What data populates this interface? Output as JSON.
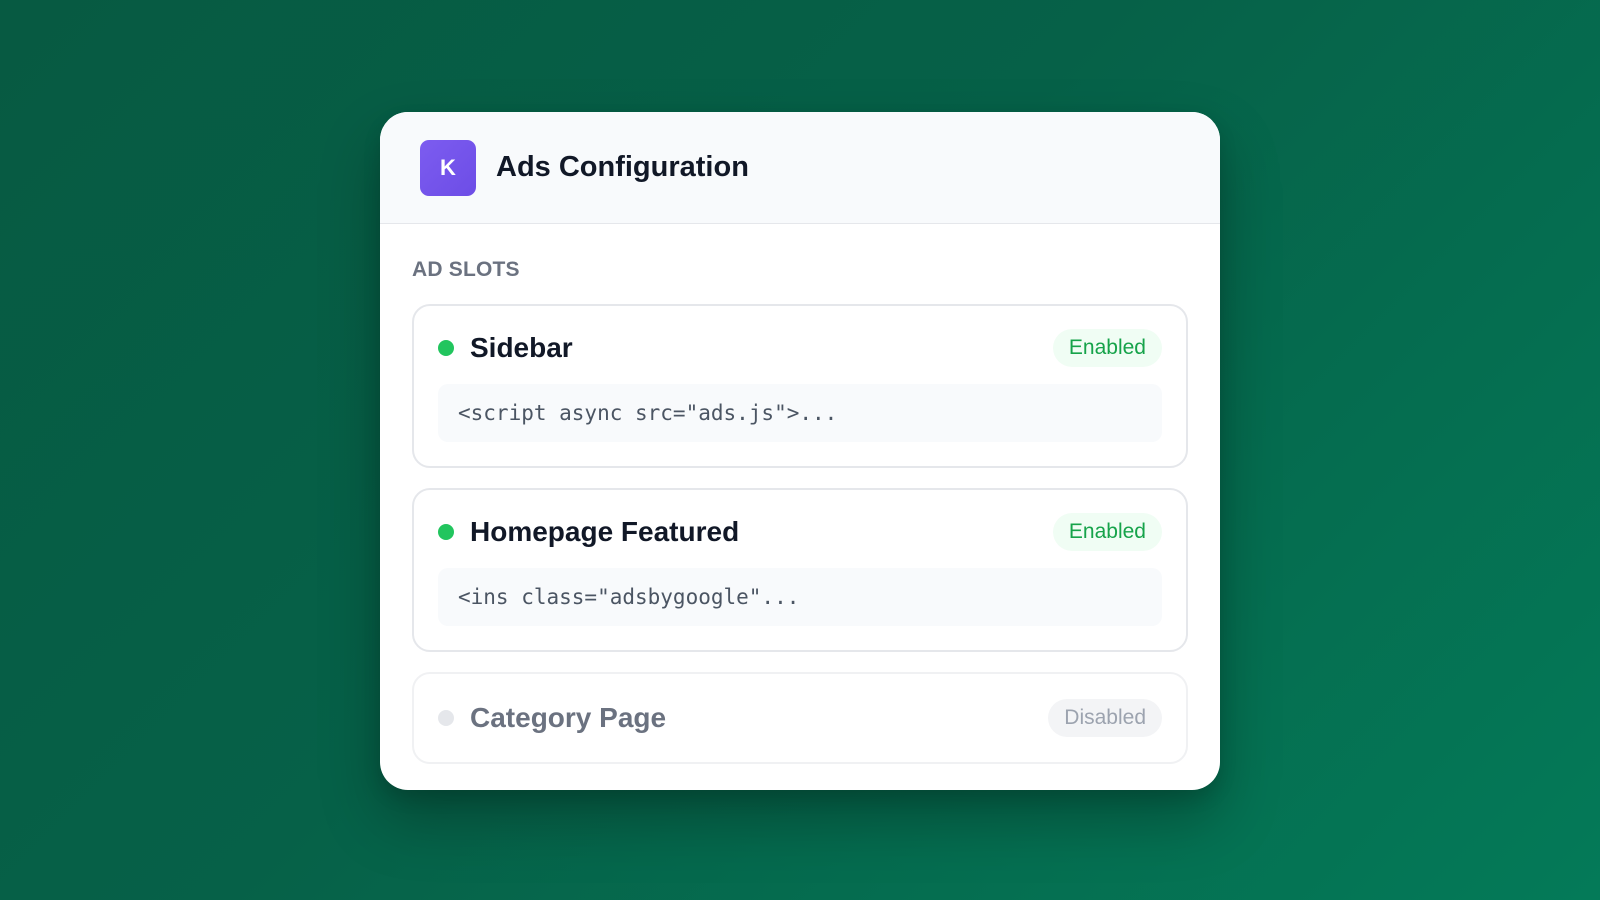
{
  "header": {
    "logo_letter": "K",
    "title": "Ads Configuration"
  },
  "section": {
    "label": "AD SLOTS"
  },
  "slots": [
    {
      "name": "Sidebar",
      "status": "Enabled",
      "code": "<script async src=\"ads.js\">..."
    },
    {
      "name": "Homepage Featured",
      "status": "Enabled",
      "code": "<ins class=\"adsbygoogle\"..."
    },
    {
      "name": "Category Page",
      "status": "Disabled"
    }
  ],
  "colors": {
    "background": "#066148",
    "accent_purple": "#7c5cf0",
    "enabled_green": "#22c55e",
    "disabled_gray": "#9ca3af"
  },
  "icons": {
    "status_dot": "status-dot-icon"
  }
}
